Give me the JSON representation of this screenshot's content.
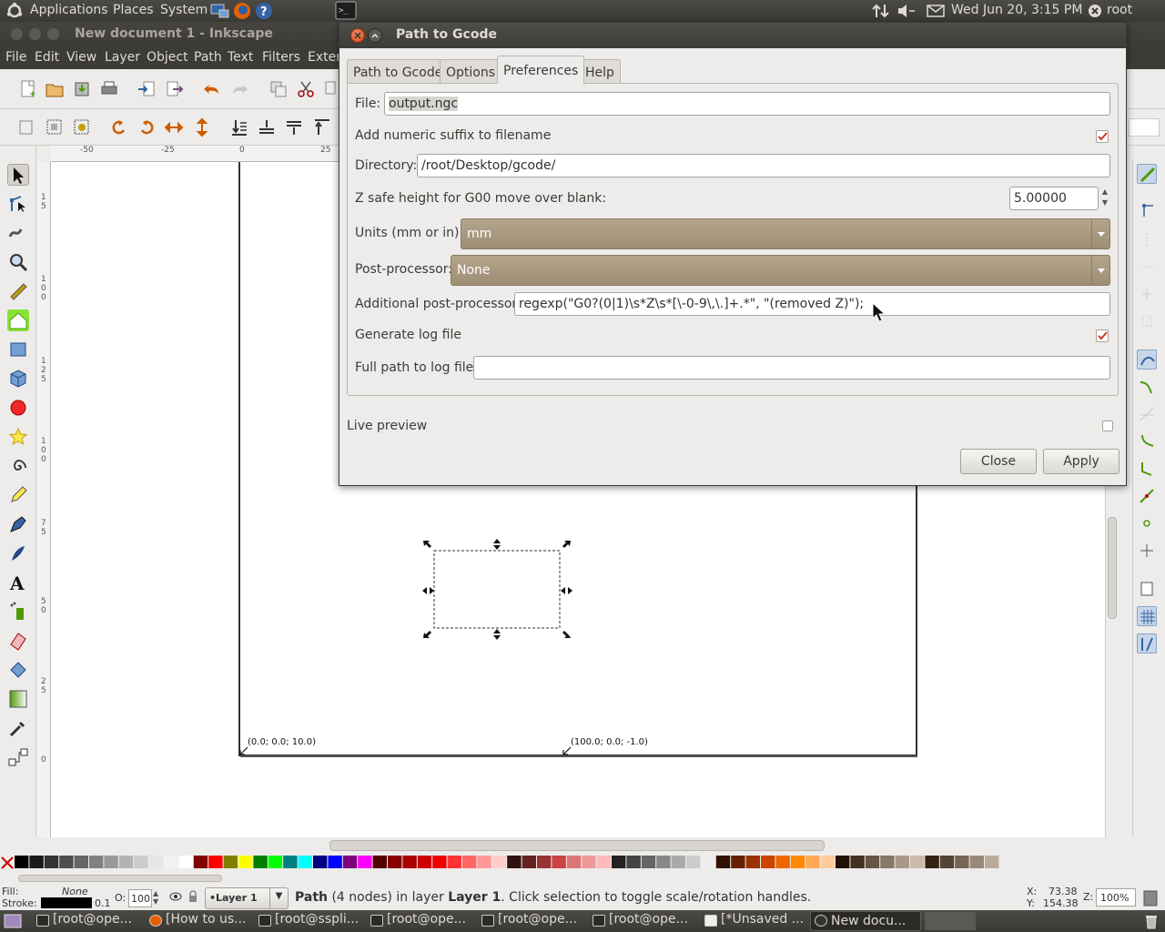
{
  "top_panel": {
    "menus": [
      "Applications",
      "Places",
      "System"
    ],
    "clock": "Wed Jun 20,  3:15 PM",
    "user": "root"
  },
  "inkscape": {
    "title": "New document 1 - Inkscape",
    "menu": [
      "File",
      "Edit",
      "View",
      "Layer",
      "Object",
      "Path",
      "Text",
      "Filters",
      "Exter"
    ],
    "ruler_h": [
      "-50",
      "-25",
      "0",
      "25"
    ],
    "ruler_v": [
      "1",
      "5",
      "1",
      "0",
      "0",
      "1",
      "2",
      "5",
      "1",
      "0",
      "0",
      "7",
      "5",
      "5",
      "0",
      "2",
      "5",
      "0"
    ],
    "canvas_labels": {
      "origin": "(0.0; 0.0; 10.0)",
      "point2": "(100.0; 0.0; -1.0)"
    }
  },
  "dialog": {
    "title": "Path to Gcode",
    "tabs": [
      "Path to Gcode",
      "Options",
      "Preferences",
      "Help"
    ],
    "active_tab": "Preferences",
    "file_label": "File:",
    "file_value": "output.ngc",
    "suffix_label": "Add numeric suffix to filename",
    "suffix_checked": true,
    "directory_label": "Directory:",
    "directory_value": "/root/Desktop/gcode/",
    "zsafe_label": "Z safe height for G00 move over blank:",
    "zsafe_value": "5.00000",
    "units_label": "Units (mm or in):",
    "units_value": "mm",
    "postproc_label": "Post-processor:",
    "postproc_value": "None",
    "addpost_label": "Additional post-processor:",
    "addpost_value": "regexp(\"G0?(0|1)\\s*Z\\s*[\\-0-9\\,\\.]+.*\", \"(removed Z)\");",
    "log_label": "Generate log file",
    "log_checked": true,
    "logpath_label": "Full path to log file:",
    "logpath_value": "",
    "live_label": "Live preview",
    "live_checked": false,
    "close_label": "Close",
    "apply_label": "Apply"
  },
  "status": {
    "fill_label": "Fill:",
    "fill_value": "None",
    "stroke_label": "Stroke:",
    "stroke_width": "0.1",
    "opacity_label": "O:",
    "opacity_value": "100",
    "layer": "•Layer 1",
    "msg_bold": "Path",
    "msg_rest1": " (4 nodes) in layer ",
    "msg_layer": "Layer 1",
    "msg_rest2": ". Click selection to toggle scale/rotation handles.",
    "x_label": "X:",
    "x_value": "73.38",
    "y_label": "Y:",
    "y_value": "154.38",
    "z_label": "Z:",
    "zoom": "100%"
  },
  "taskbar": [
    "[root@ope...",
    "[How to us...",
    "[root@sspli...",
    "[root@ope...",
    "[root@ope...",
    "[root@ope...",
    "[*Unsaved ...",
    "New docu..."
  ],
  "colors": {
    "accent": "#dd4814",
    "combo": "#a8987e",
    "check": "#d33a2c"
  }
}
